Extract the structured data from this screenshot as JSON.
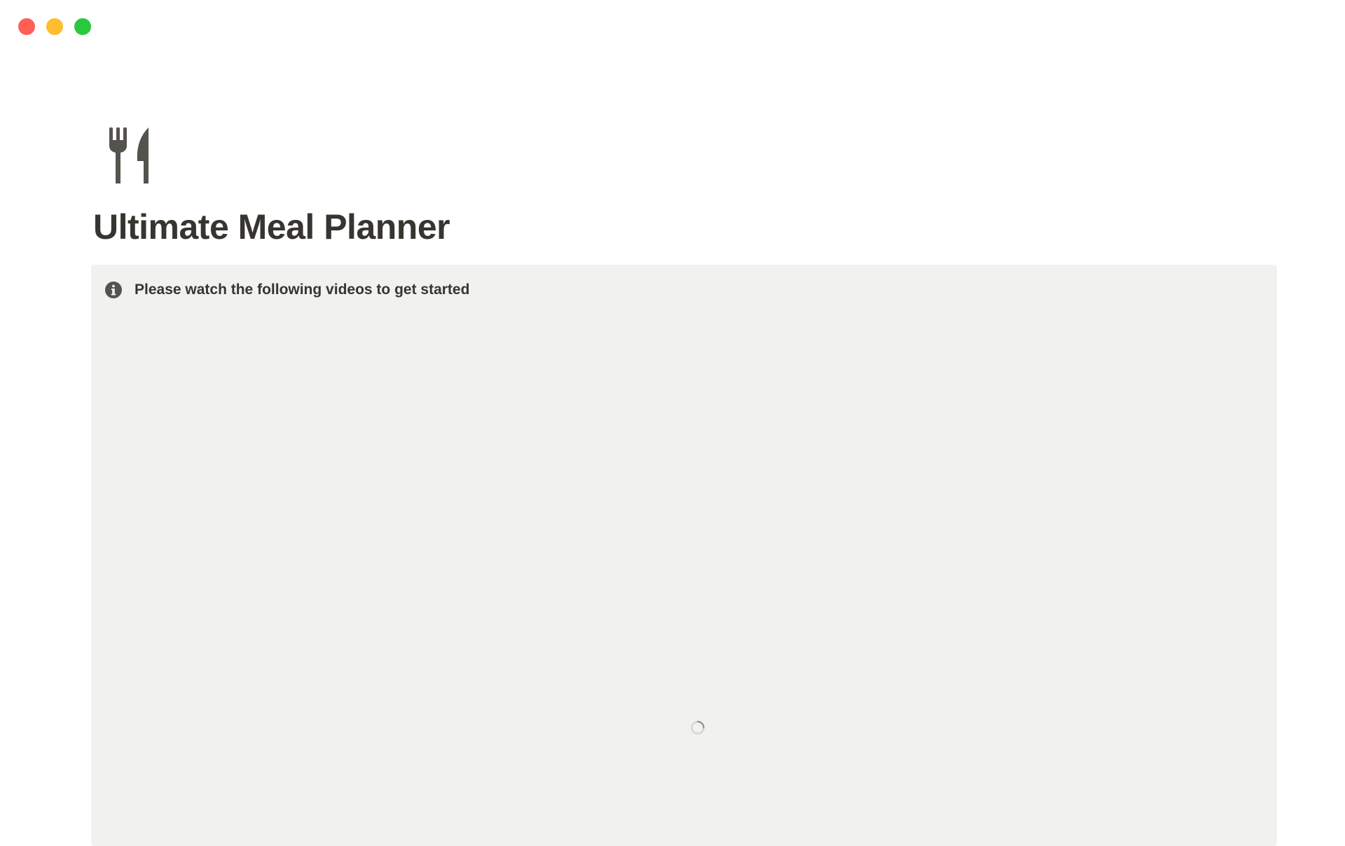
{
  "window": {
    "controls": [
      {
        "name": "close",
        "color": "#ff5f57"
      },
      {
        "name": "minimize",
        "color": "#febc2e"
      },
      {
        "name": "maximize",
        "color": "#28c840"
      }
    ]
  },
  "page": {
    "icon": "fork-knife-icon",
    "title": "Ultimate Meal Planner"
  },
  "callout": {
    "icon": "info-icon",
    "text": "Please watch the following videos to get started",
    "background": "#f1f1ef",
    "state": "loading-spinner"
  }
}
